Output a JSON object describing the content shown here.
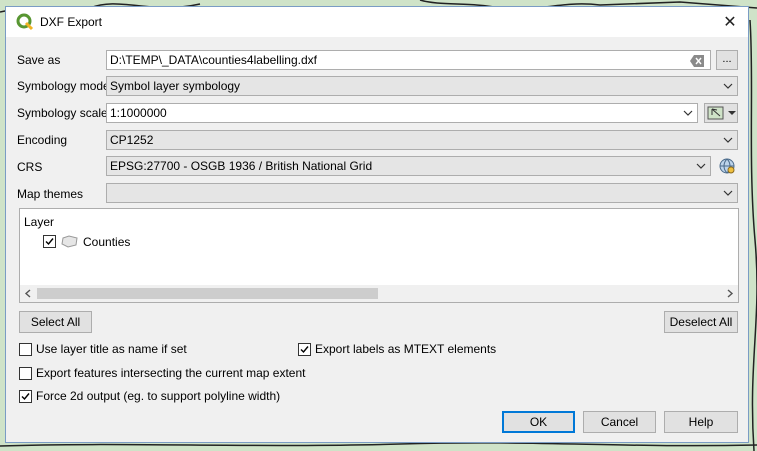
{
  "window": {
    "title": "DXF Export",
    "close_symbol": "✕"
  },
  "form": {
    "save_as": {
      "label": "Save as",
      "value": "D:\\TEMP\\_DATA\\counties4labelling.dxf",
      "browse_label": "..."
    },
    "symbology_mode": {
      "label": "Symbology mode",
      "value": "Symbol layer symbology"
    },
    "symbology_scale": {
      "label": "Symbology scale",
      "value": "1:1000000"
    },
    "encoding": {
      "label": "Encoding",
      "value": "CP1252"
    },
    "crs": {
      "label": "CRS",
      "value": "EPSG:27700 - OSGB 1936 / British National Grid"
    },
    "map_themes": {
      "label": "Map themes",
      "value": ""
    }
  },
  "layers": {
    "header": "Layer",
    "items": [
      {
        "name": "Counties",
        "checked": true
      }
    ]
  },
  "buttons": {
    "select_all": "Select All",
    "deselect_all": "Deselect All",
    "ok": "OK",
    "cancel": "Cancel",
    "help": "Help"
  },
  "options": {
    "use_layer_title": {
      "label": "Use layer title as name if set",
      "checked": false
    },
    "export_labels_mtext": {
      "label": "Export labels as MTEXT elements",
      "checked": true
    },
    "export_intersecting": {
      "label": "Export features intersecting the current map extent",
      "checked": false
    },
    "force_2d": {
      "label": "Force 2d output (eg. to support polyline width)",
      "checked": true
    }
  },
  "colors": {
    "accent": "#0078d7",
    "qgis_green": "#589632",
    "map_background": "#cfe3c8"
  }
}
